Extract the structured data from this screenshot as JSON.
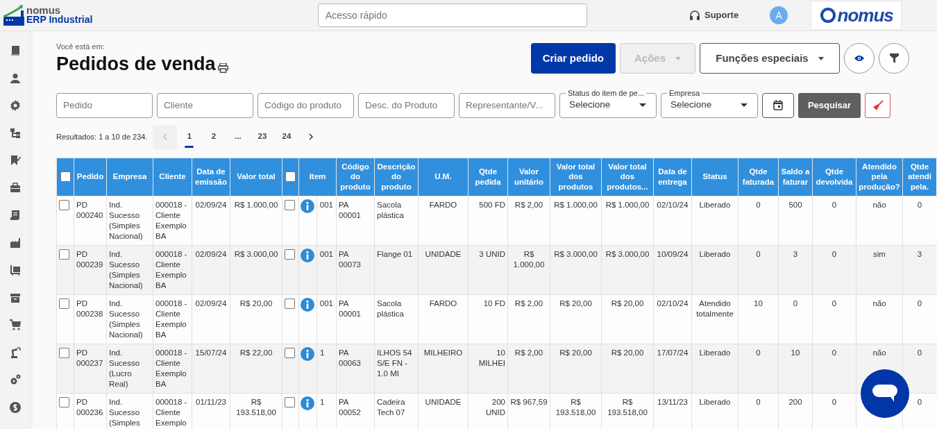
{
  "header": {
    "logo": {
      "line1": "nomus",
      "line2": "ERP Industrial"
    },
    "quick_access": {
      "placeholder": "Acesso rápido"
    },
    "support": "Suporte",
    "avatar": "A",
    "brand": "nomus"
  },
  "page": {
    "breadcrumb": "Você está em:",
    "title": "Pedidos de venda",
    "buttons": [
      {
        "label": "Criar pedido",
        "kind": "primary",
        "disabled": false
      },
      {
        "label": "Ações",
        "kind": "dropdown",
        "disabled": true
      },
      {
        "label": "Funções especiais",
        "kind": "dropdown",
        "disabled": false
      }
    ],
    "filters": [
      {
        "kind": "text",
        "placeholder": "Pedido"
      },
      {
        "kind": "text",
        "placeholder": "Cliente"
      },
      {
        "kind": "text",
        "placeholder": "Código do produto"
      },
      {
        "kind": "text",
        "placeholder": "Desc. do Produto"
      },
      {
        "kind": "text",
        "placeholder": "Representante/V..."
      },
      {
        "kind": "select",
        "label": "Status do item de pe...",
        "value": "Selecione"
      },
      {
        "kind": "select",
        "label": "Empresa",
        "value": "Selecione"
      }
    ],
    "search_button": "Pesquisar",
    "results": "Resultados: 1 a 10 de 234.",
    "pages": [
      {
        "label": "1",
        "selected": true
      },
      {
        "label": "2",
        "selected": false
      },
      {
        "label": "...",
        "selected": false
      },
      {
        "label": "23",
        "selected": false
      },
      {
        "label": "24",
        "selected": false
      }
    ]
  },
  "table": {
    "columns": [
      {
        "kind": "check",
        "checked": false
      },
      {
        "kind": "text",
        "label": "Pedido"
      },
      {
        "kind": "text",
        "label": "Empresa"
      },
      {
        "kind": "text",
        "label": "Cliente"
      },
      {
        "kind": "text",
        "label": "Data de emissão"
      },
      {
        "kind": "text",
        "label": "Valor total"
      },
      {
        "kind": "check",
        "checked": false
      },
      {
        "kind": "item",
        "label": "Item"
      },
      {
        "kind": "text",
        "label": "Código do produto"
      },
      {
        "kind": "text",
        "label": "Descrição do produto"
      },
      {
        "kind": "text",
        "label": "U.M."
      },
      {
        "kind": "text",
        "label": "Qtde pedida"
      },
      {
        "kind": "text",
        "label": "Valor unitário"
      },
      {
        "kind": "text",
        "label": "Valor total dos produtos"
      },
      {
        "kind": "text",
        "label": "Valor total dos produtos..."
      },
      {
        "kind": "text",
        "label": "Data de entrega"
      },
      {
        "kind": "text",
        "label": "Status"
      },
      {
        "kind": "text",
        "label": "Qtde faturada"
      },
      {
        "kind": "text",
        "label": "Saldo a faturar"
      },
      {
        "kind": "text",
        "label": "Qtde devolvida"
      },
      {
        "kind": "text",
        "label": "Atendido pela produção?"
      },
      {
        "kind": "text",
        "label": "Qtde atendi pela."
      }
    ],
    "rows": [
      {
        "checks": [
          false,
          false
        ],
        "values": [
          "PD 000240",
          "Ind. Sucesso (Simples Nacional)",
          "000018 - Cliente Exemplo BA",
          "02/09/24",
          "R$ 1.000,00",
          "001",
          "PA 00001",
          "Sacola plástica",
          "FARDO",
          "500 FD",
          "R$ 2,00",
          "R$ 1.000,00",
          "R$ 1.000,00",
          "02/10/24",
          "Liberado",
          "0",
          "500",
          "0"
        ],
        "atendido": "não",
        "qtde_atendida": "0"
      },
      {
        "checks": [
          false,
          false
        ],
        "values": [
          "PD 000239",
          "Ind. Sucesso (Simples Nacional)",
          "000018 - Cliente Exemplo BA",
          "02/09/24",
          "R$ 3.000,00",
          "001",
          "PA 00073",
          "Flange 01",
          "UNIDADE",
          "3 UNID",
          "R$ 1.000,00",
          "R$ 3.000,00",
          "R$ 3.000,00",
          "10/09/24",
          "Liberado",
          "0",
          "3",
          "0"
        ],
        "atendido": "sim",
        "qtde_atendida": "3"
      },
      {
        "checks": [
          false,
          false
        ],
        "values": [
          "PD 000238",
          "Ind. Sucesso (Simples Nacional)",
          "000018 - Cliente Exemplo BA",
          "02/09/24",
          "R$ 20,00",
          "001",
          "PA 00001",
          "Sacola plástica",
          "FARDO",
          "10 FD",
          "R$ 2,00",
          "R$ 20,00",
          "R$ 20,00",
          "02/10/24",
          "Atendido totalmente",
          "10",
          "0",
          "0"
        ],
        "atendido": "não",
        "qtde_atendida": "0"
      },
      {
        "checks": [
          false,
          false
        ],
        "values": [
          "PD 000237",
          "Ind. Sucesso (Lucro Real)",
          "000018 - Cliente Exemplo BA",
          "15/07/24",
          "R$ 22,00",
          "1",
          "PA 00063",
          "ILHOS 54 S/E FN - 1.0 MI",
          "MILHEIRO",
          "10 MILHEI",
          "R$ 2,00",
          "R$ 20,00",
          "R$ 20,00",
          "17/07/24",
          "Liberado",
          "0",
          "10",
          "0"
        ],
        "atendido": "não",
        "qtde_atendida": "0"
      },
      {
        "checks": [
          false,
          false
        ],
        "values": [
          "PD 000236",
          "Ind. Sucesso (Simples",
          "000018 - Cliente Exemplo",
          "01/11/23",
          "R$ 193.518,00",
          "1",
          "PA 00052",
          "Cadeira Tech 07",
          "UNIDADE",
          "200 UNID",
          "R$ 967,59",
          "R$ 193.518,00",
          "R$ 193.518,00",
          "13/11/23",
          "Liberado",
          "0",
          "200",
          "0"
        ],
        "qtde_atendida": "0"
      }
    ]
  }
}
